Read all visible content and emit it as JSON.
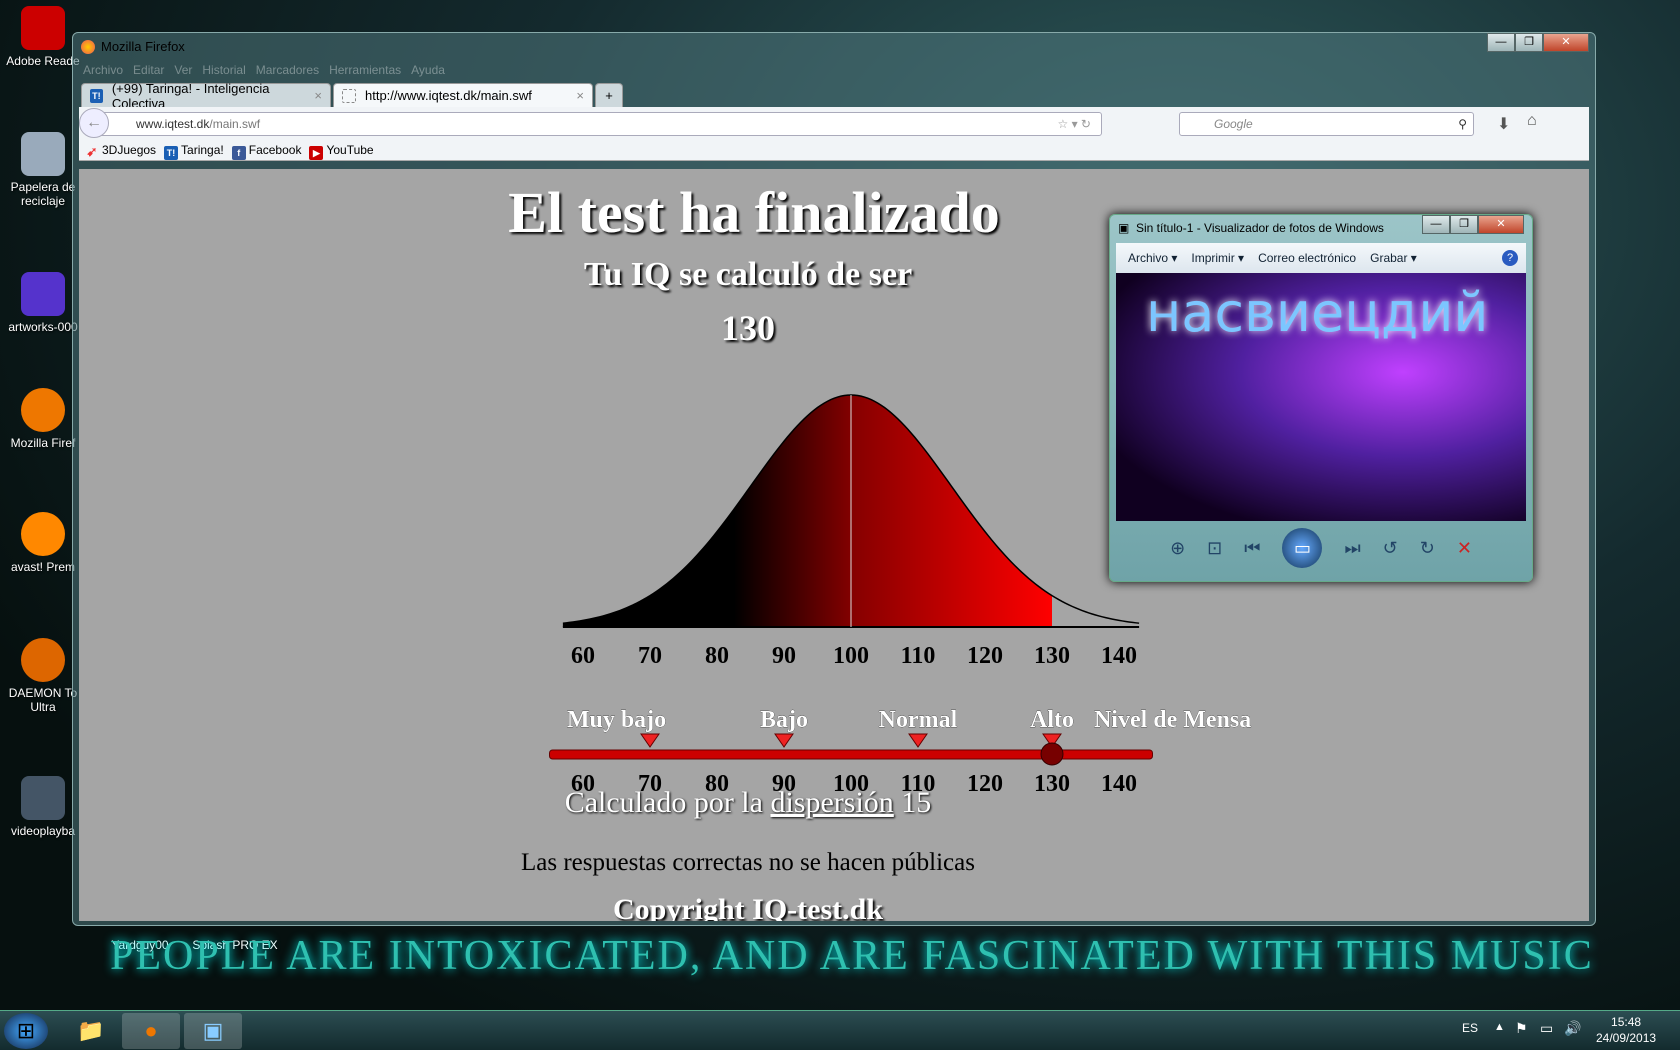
{
  "desktop": {
    "icons": [
      "Adobe Reade",
      "Papelera de reciclaje",
      "artworks-000",
      "Mozilla Firef",
      "avast! Prem",
      "DAEMON To Ultra",
      "videoplayba"
    ],
    "bottom_icons": [
      "Yardguy00",
      "Splash PRO EX"
    ],
    "wallpaper_text": "PEOPLE ARE INTOXICATED, AND ARE FASCINATED WITH THIS MUSIC"
  },
  "firefox": {
    "title": "Mozilla Firefox",
    "menu": [
      "Archivo",
      "Editar",
      "Ver",
      "Historial",
      "Marcadores",
      "Herramientas",
      "Ayuda"
    ],
    "tabs": [
      {
        "label": "(+99) Taringa! - Inteligencia Colectiva"
      },
      {
        "label": "http://www.iqtest.dk/main.swf"
      }
    ],
    "url_domain": "www.iqtest.dk",
    "url_path": "/main.swf",
    "search_placeholder": "Google",
    "bookmarks": [
      "3DJuegos",
      "Taringa!",
      "Facebook",
      "YouTube"
    ]
  },
  "page": {
    "title": "El test ha finalizado",
    "subtitle": "Tu IQ se calculó de ser",
    "iq": "130",
    "axis_ticks": [
      "60",
      "70",
      "80",
      "90",
      "100",
      "110",
      "120",
      "130",
      "140"
    ],
    "categories": [
      "Muy bajo",
      "Bajo",
      "Normal",
      "Alto",
      "Nivel de Mensa"
    ],
    "dispersion_prefix": "Calculado por la",
    "dispersion_link": "dispersión",
    "dispersion_value": "15",
    "note": "Las respuestas correctas no se hacen públicas",
    "copyright": "Copyright IQ-test.dk",
    "iq_value": 130,
    "mean": 100,
    "sd": 15,
    "range": [
      60,
      140
    ]
  },
  "viewer": {
    "title": "Sin título-1 - Visualizador de fotos de Windows",
    "menu": [
      "Archivo ▾",
      "Imprimir ▾",
      "Correo electrónico",
      "Grabar ▾"
    ],
    "photo_text": "насвиецдий"
  },
  "taskbar": {
    "lang": "ES",
    "time": "15:48",
    "date": "24/09/2013"
  }
}
